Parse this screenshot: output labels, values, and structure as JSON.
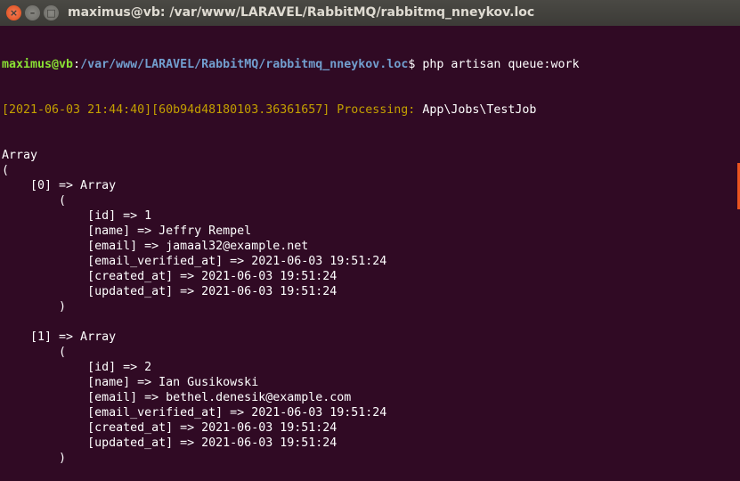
{
  "window": {
    "title": "maximus@vb: /var/www/LARAVEL/RabbitMQ/rabbitmq_nneykov.loc",
    "close": "×",
    "minimize": "–",
    "maximize": "□"
  },
  "prompt": {
    "user": "maximus@vb",
    "sep": ":",
    "path": "/var/www/LARAVEL/RabbitMQ/rabbitmq_nneykov.loc",
    "dollar": "$ ",
    "command": "php artisan queue:work"
  },
  "log": {
    "prefix": "[2021-06-03 21:44:40][60b94d48180103.36361657] Processing: ",
    "job": "App\\Jobs\\TestJob"
  },
  "output": [
    "Array",
    "(",
    "    [0] => Array",
    "        (",
    "            [id] => 1",
    "            [name] => Jeffry Rempel",
    "            [email] => jamaal32@example.net",
    "            [email_verified_at] => 2021-06-03 19:51:24",
    "            [created_at] => 2021-06-03 19:51:24",
    "            [updated_at] => 2021-06-03 19:51:24",
    "        )",
    "",
    "    [1] => Array",
    "        (",
    "            [id] => 2",
    "            [name] => Ian Gusikowski",
    "            [email] => bethel.denesik@example.com",
    "            [email_verified_at] => 2021-06-03 19:51:24",
    "            [created_at] => 2021-06-03 19:51:24",
    "            [updated_at] => 2021-06-03 19:51:24",
    "        )"
  ]
}
